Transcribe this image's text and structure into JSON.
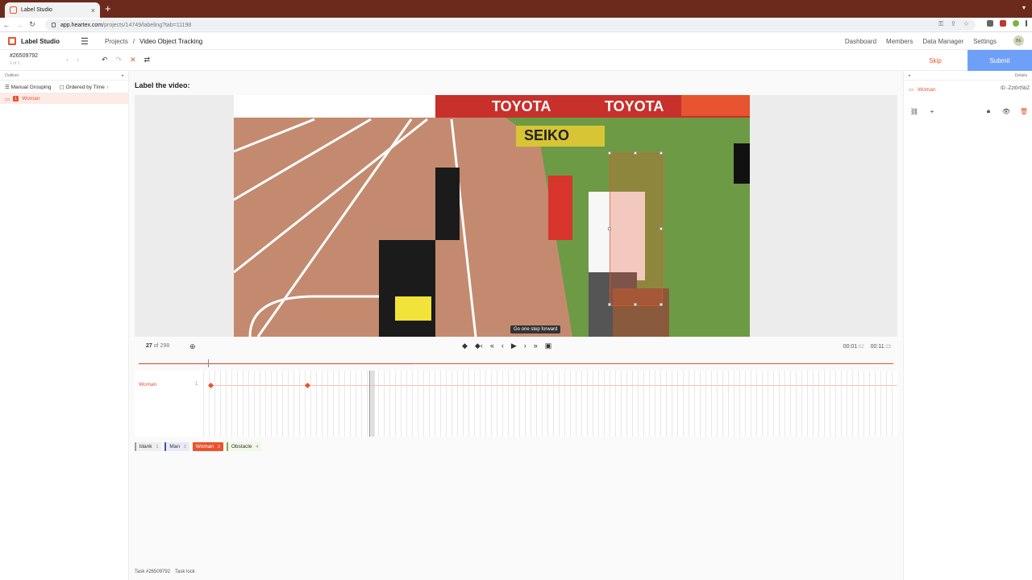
{
  "browser": {
    "tab_title": "Label Studio",
    "url_host": "app.heartex.com",
    "url_path": "/projects/14749/labeling?tab=11198"
  },
  "app": {
    "name": "Label Studio",
    "breadcrumb": [
      "Projects",
      "/",
      "Video Object Tracking"
    ],
    "nav": [
      "Dashboard",
      "Members",
      "Data Manager",
      "Settings"
    ],
    "avatar_initials": "BE"
  },
  "task": {
    "id": "#26509792",
    "position": "1 of 1"
  },
  "actions": {
    "skip": "Skip",
    "submit": "Submit"
  },
  "outliner": {
    "title": "Outliner",
    "grouping": "Manual Grouping",
    "order": "Ordered by Time",
    "items": [
      {
        "label": "Woman",
        "index": "1"
      }
    ]
  },
  "editor": {
    "instruction": "Label the video:",
    "frame_current": "27",
    "frame_total": "of 298",
    "tooltip": "Go one step forward",
    "time_current": "00:01",
    "time_current_frac": ":02",
    "time_total": "00:11",
    "time_total_frac": ":23"
  },
  "timeline": {
    "rows": [
      {
        "label": "Woman",
        "index": "1",
        "keyframes": [
          27,
          102
        ]
      }
    ]
  },
  "labels": [
    {
      "name": "blank",
      "hotkey": "1",
      "color": "#9e9e9e"
    },
    {
      "name": "Man",
      "hotkey": "2",
      "color": "#3f51b5"
    },
    {
      "name": "Woman",
      "hotkey": "3",
      "color": "#e8542f"
    },
    {
      "name": "Obstacle",
      "hotkey": "4",
      "color": "#7cb342"
    }
  ],
  "details": {
    "title": "Details",
    "region_label": "Woman",
    "region_id": "ID -Zzt0rtSbZ"
  },
  "footer": {
    "task": "Task #26509792",
    "lock": "Task lock"
  },
  "colors": {
    "accent": "#e8542f",
    "submit": "#6ea0f7",
    "tabbar": "#6b2a1c"
  }
}
